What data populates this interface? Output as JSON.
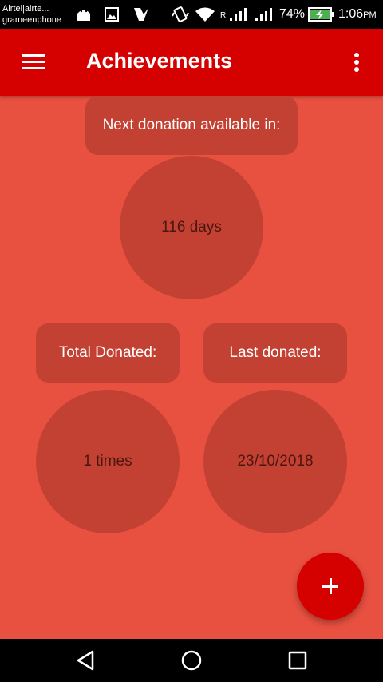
{
  "status_bar": {
    "carrier_line1": "Airtel|airte...",
    "carrier_line2": "grameenphone",
    "roaming": "R",
    "battery": "74%",
    "time": "1:06",
    "ampm": "PM",
    "icons": [
      "android-icon",
      "image-icon",
      "checkmark-icon",
      "vibrate-icon",
      "wifi-icon",
      "signal-icon",
      "signal-icon",
      "battery-charging-icon"
    ]
  },
  "app_bar": {
    "title": "Achievements",
    "menu_icon": "hamburger-menu-icon",
    "overflow_icon": "more-vert-icon"
  },
  "main": {
    "next_donation_label": "Next donation available in:",
    "next_donation_value": "116 days",
    "total_donated_label": "Total Donated:",
    "total_donated_value": "1 times",
    "last_donated_label": "Last donated:",
    "last_donated_value": "23/10/2018"
  },
  "fab": {
    "icon": "plus-icon"
  },
  "nav_bar": {
    "icons": [
      "back-icon",
      "home-icon",
      "recents-icon"
    ]
  },
  "colors": {
    "background": "#e85040",
    "app_bar": "#d50000",
    "card": "#c24133",
    "fab": "#d50000"
  }
}
